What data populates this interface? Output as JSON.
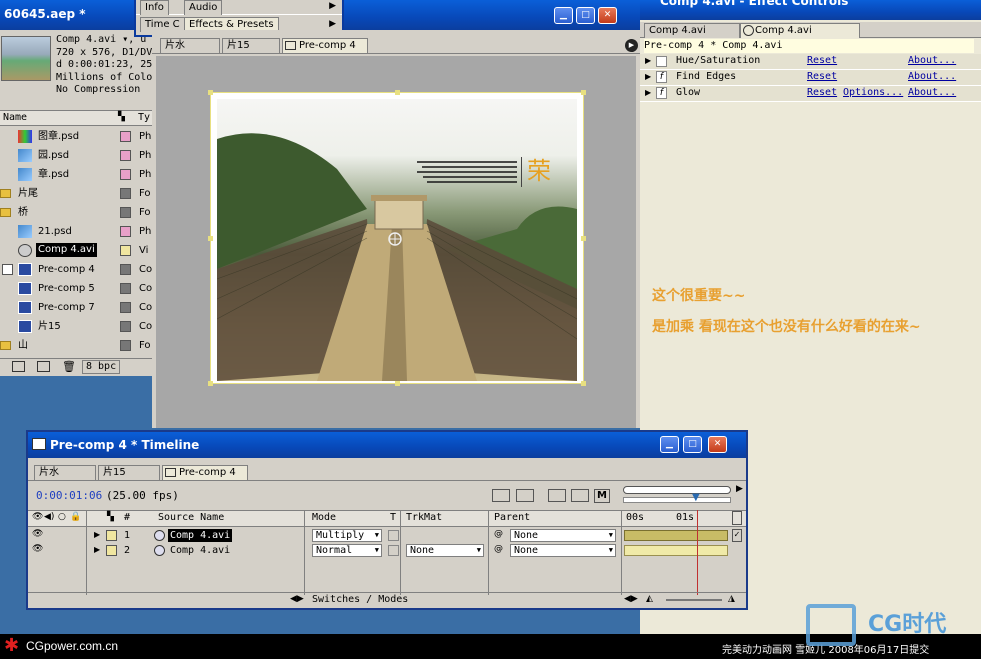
{
  "project": {
    "title": "60645.aep *",
    "info_comp": "Comp 4.avi ▾, u",
    "info_lines": [
      "720 x 576, D1/DV",
      "d 0:00:01:23, 25",
      "Millions of Colo",
      "No Compression"
    ],
    "col_name": "Name",
    "col_type": "Ty",
    "items": [
      {
        "name": "图章.psd",
        "type": "Ph"
      },
      {
        "name": "园.psd",
        "type": "Ph"
      },
      {
        "name": "章.psd",
        "type": "Ph"
      },
      {
        "name": "片尾",
        "type": "Fo"
      },
      {
        "name": "桥",
        "type": "Fo"
      },
      {
        "name": "21.psd",
        "type": "Ph"
      },
      {
        "name": "Comp 4.avi",
        "type": "Vi"
      },
      {
        "name": "Pre-comp 4",
        "type": "Co"
      },
      {
        "name": "Pre-comp 5",
        "type": "Co"
      },
      {
        "name": "Pre-comp 7",
        "type": "Co"
      },
      {
        "name": "片15",
        "type": "Co"
      },
      {
        "name": "山",
        "type": "Fo"
      }
    ],
    "bpc": "8 bpc"
  },
  "palette": {
    "info": "Info",
    "audio": "Audio",
    "time_controls": "Time C",
    "effects_presets": "Effects & Presets"
  },
  "comp_viewer": {
    "tabs": [
      "片水",
      "片15",
      "Pre-comp 4"
    ],
    "magazine_char": "荣"
  },
  "effect_controls": {
    "title": "Comp 4.avi - Effect Controls",
    "tab1": "Comp 4.avi",
    "tab2": "Comp 4.avi",
    "breadcrumb": "Pre-comp 4 * Comp 4.avi",
    "effects": [
      {
        "name": "Hue/Saturation",
        "reset": "Reset",
        "options": "",
        "about": "About..."
      },
      {
        "name": "Find Edges",
        "reset": "Reset",
        "options": "",
        "about": "About..."
      },
      {
        "name": "Glow",
        "reset": "Reset",
        "options": "Options...",
        "about": "About..."
      }
    ],
    "annotation1": "这个很重要~~",
    "annotation2": "是加乘 看现在这个也没有什么好看的在来~"
  },
  "timeline": {
    "title": "Pre-comp 4 * Timeline",
    "tabs": [
      "片水",
      "片15",
      "Pre-comp 4"
    ],
    "timecode": "0:00:01:06",
    "fps": "(25.00 fps)",
    "cols": {
      "num": "#",
      "source": "Source Name",
      "mode": "Mode",
      "t": "T",
      "trkmat": "TrkMat",
      "parent": "Parent"
    },
    "ruler": [
      "00s",
      "01s"
    ],
    "layers": [
      {
        "num": "1",
        "name": "Comp 4.avi",
        "mode": "Multiply",
        "trkmat": "",
        "parent": "None"
      },
      {
        "num": "2",
        "name": "Comp 4.avi",
        "mode": "Normal",
        "trkmat": "None",
        "parent": "None"
      }
    ],
    "switches_modes": "Switches / Modes",
    "m_button": "M"
  },
  "footer": {
    "left": "CGpower.com.cn",
    "right": "完美动力动画网 雪姬儿 2008年06月17日提交",
    "logo": "CG时代"
  }
}
